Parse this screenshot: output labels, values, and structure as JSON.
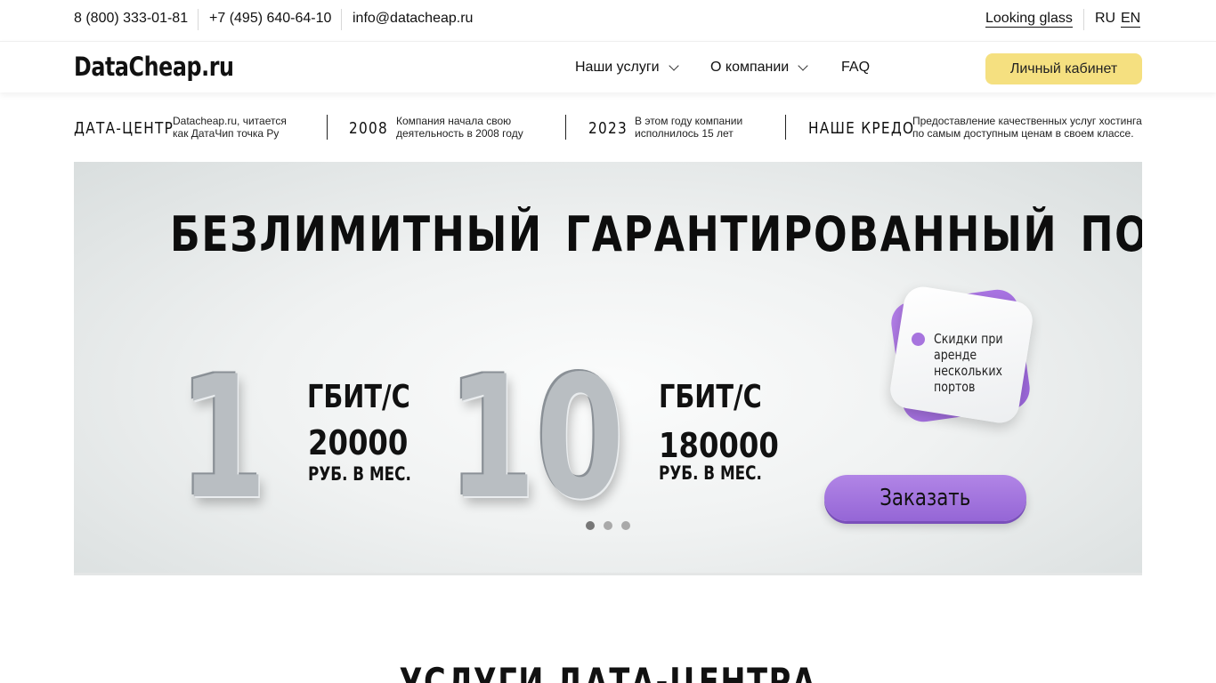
{
  "topbar": {
    "phone1": "8 (800) 333-01-81",
    "phone2": "+7 (495) 640-64-10",
    "email": "info@datacheap.ru",
    "looking_glass": "Looking glass",
    "lang_ru": "RU",
    "lang_en": "EN"
  },
  "header": {
    "logo": "DataCheap.ru",
    "nav": {
      "services": "Наши услуги",
      "about": "О компании",
      "faq": "FAQ"
    },
    "cabinet": "Личный кабинет"
  },
  "facts": [
    {
      "head": "ДАТА-ЦЕНТР",
      "line1": "Datacheap.ru, читается",
      "line2": "как ДатаЧип точка Ру"
    },
    {
      "head": "2008",
      "line1": "Компания начала свою",
      "line2": "деятельность в 2008 году"
    },
    {
      "head": "2023",
      "line1": "В этом году компании",
      "line2": "исполнилось 15 лет"
    },
    {
      "head": "НАШЕ КРЕДО",
      "line1": "Предоставление качественных услуг хостинга",
      "line2": "по самым доступным ценам в своем классе."
    }
  ],
  "banner": {
    "headline": "БЕЗЛИМИТНЫЙ ГАРАНТИРОВАННЫЙ ПОРТ",
    "offers": [
      {
        "speed": "1",
        "unit": "ГБИТ/С",
        "price": "20000",
        "period": "РУБ. В МЕС."
      },
      {
        "speed": "10",
        "unit": "ГБИТ/С",
        "price": "180000",
        "period": "РУБ. В МЕС."
      }
    ],
    "promo": "Скидки при аренде нескольких портов",
    "order_button": "Заказать",
    "slides": {
      "count": 3,
      "active_index": 0
    },
    "accent_color": "#9f70dd"
  },
  "section": {
    "title": "УСЛУГИ ДАТА-ЦЕНТРА"
  },
  "colors": {
    "cabinet_button": "#f5e080",
    "order_button": "#a274dd"
  }
}
